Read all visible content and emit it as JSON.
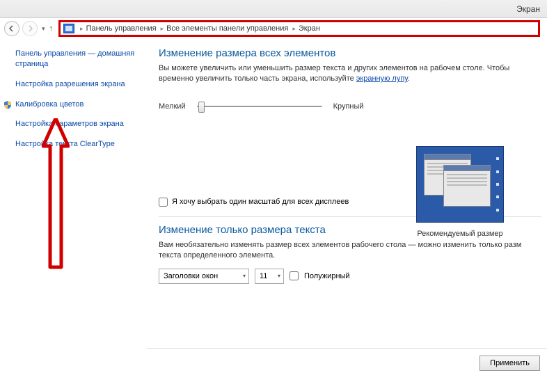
{
  "titlebar": {
    "title": "Экран"
  },
  "nav": {
    "crumb1": "Панель управления",
    "crumb2": "Все элементы панели управления",
    "crumb3": "Экран"
  },
  "sidebar": {
    "home": "Панель управления — домашняя страница",
    "resolution": "Настройка разрешения экрана",
    "calibration": "Калибровка цветов",
    "params": "Настройка параметров экрана",
    "cleartype": "Настройка текста ClearType"
  },
  "main": {
    "h1": "Изменение размера всех элементов",
    "desc1": "Вы можете увеличить или уменьшить размер текста и других элементов на рабочем столе. Чтобы временно увеличить только часть экрана, используйте ",
    "magnifier_link": "экранную лупу",
    "desc1_end": ".",
    "slider_small": "Мелкий",
    "slider_large": "Крупный",
    "preview_caption": "Рекомендуемый размер",
    "checkbox_label": "Я хочу выбрать один масштаб для всех дисплеев",
    "h2": "Изменение только размера текста",
    "desc2": "Вам необязательно изменять размер всех элементов рабочего стола — можно изменить только разм текста определенного элемента.",
    "select_element": "Заголовки окон",
    "select_size": "11",
    "bold_label": "Полужирный",
    "apply": "Применить"
  }
}
